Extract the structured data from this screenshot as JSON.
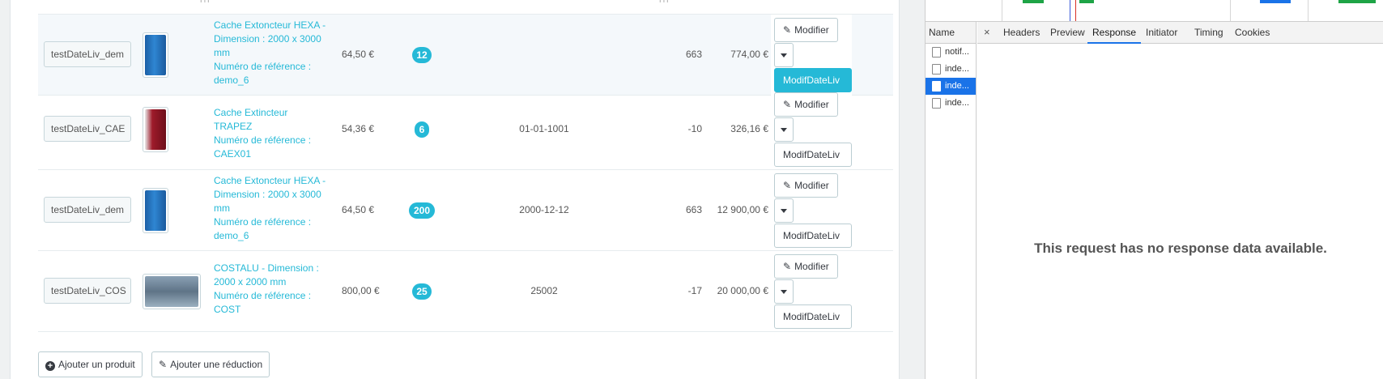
{
  "table": {
    "head_ht_left": "HT",
    "head_ht_right": "HT",
    "rows": [
      {
        "reference": "testDateLiv_dem",
        "name_line1": "Cache Extoncteur HEXA -",
        "name_line2": "Dimension : 2000 x 3000",
        "name_line3": "mm",
        "name_line4": "Numéro de référence :",
        "name_line5": "demo_6",
        "price": "64,50 €",
        "quantity": "12",
        "date": "",
        "stock": "663",
        "total": "774,00 €",
        "thumb_icon": "extinguisher-cabinet-blue-image"
      },
      {
        "reference": "testDateLiv_CAE",
        "name_line1": "Cache Extincteur TRAPEZ",
        "name_line2": "Numéro de référence :",
        "name_line3": "CAEX01",
        "name_line4": "",
        "name_line5": "",
        "price": "54,36 €",
        "quantity": "6",
        "date": "01-01-1001",
        "stock": "-10",
        "total": "326,16 €",
        "thumb_icon": "extinguisher-cabinet-red-image"
      },
      {
        "reference": "testDateLiv_dem",
        "name_line1": "Cache Extoncteur HEXA -",
        "name_line2": "Dimension : 2000 x 3000",
        "name_line3": "mm",
        "name_line4": "Numéro de référence :",
        "name_line5": "demo_6",
        "price": "64,50 €",
        "quantity": "200",
        "date": "2000-12-12",
        "stock": "663",
        "total": "12 900,00 €",
        "thumb_icon": "extinguisher-cabinet-blue-image"
      },
      {
        "reference": "testDateLiv_COS",
        "name_line1": "COSTALU - Dimension :",
        "name_line2": "2000 x 2000 mm",
        "name_line3": "Numéro de référence :",
        "name_line4": "COST",
        "name_line5": "",
        "price": "800,00 €",
        "quantity": "25",
        "date": "25002",
        "stock": "-17",
        "total": "20 000,00 €",
        "thumb_icon": "aluminium-plate-image"
      }
    ],
    "actions": {
      "modify_label": "Modifier",
      "modif_date_label": "ModifDateLiv"
    },
    "footer": {
      "add_product": "Ajouter un produit",
      "add_discount": "Ajouter une réduction"
    }
  },
  "devtools": {
    "name_header": "Name",
    "requests": [
      "notif...",
      "inde...",
      "inde...",
      "inde..."
    ],
    "selected_request_index": 2,
    "tabs": [
      "Headers",
      "Preview",
      "Response",
      "Initiator",
      "Timing",
      "Cookies"
    ],
    "active_tab": "Response",
    "close_glyph": "×",
    "empty_message": "This request has no response data available."
  },
  "colors": {
    "accent": "#25b9d7",
    "devtools_selection": "#1a73e8"
  }
}
